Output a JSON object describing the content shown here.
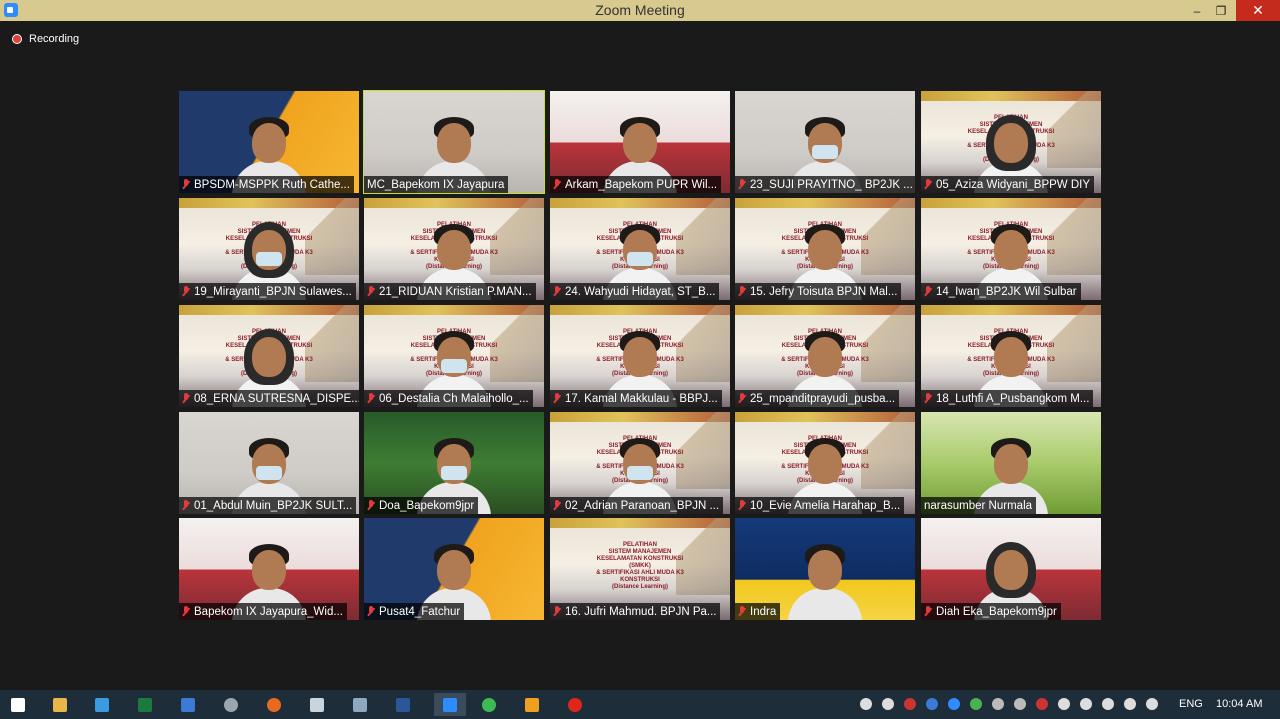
{
  "window": {
    "title": "Zoom Meeting",
    "minimize": "–",
    "maximize": "❐",
    "close": "✕"
  },
  "recording": {
    "label": "Recording"
  },
  "participants": [
    {
      "name": "BPSDM-MSPPK Ruth Cathe...",
      "bg": "orange",
      "person": "woman",
      "muted": true,
      "active": false
    },
    {
      "name": "MC_Bapekom IX Jayapura",
      "bg": "room",
      "person": "man",
      "muted": false,
      "active": true
    },
    {
      "name": "Arkam_Bapekom PUPR Wil...",
      "bg": "red",
      "person": "man",
      "muted": true,
      "active": false
    },
    {
      "name": "23_SUJI PRAYITNO_ BP2JK ...",
      "bg": "room",
      "person": "man-mask",
      "muted": true,
      "active": false
    },
    {
      "name": "05_Aziza Widyani_BPPW DIY",
      "bg": "slide",
      "person": "hijab",
      "muted": true,
      "active": false
    },
    {
      "name": "19_Mirayanti_BPJN Sulawes...",
      "bg": "slide",
      "person": "hijab-mask",
      "muted": true,
      "active": false
    },
    {
      "name": "21_RIDUAN Kristian P.MAN...",
      "bg": "slide",
      "person": "man",
      "muted": true,
      "active": false
    },
    {
      "name": "24. Wahyudi Hidayat, ST_B...",
      "bg": "slide",
      "person": "man-mask",
      "muted": true,
      "active": false
    },
    {
      "name": "15. Jefry Toisuta BPJN Mal...",
      "bg": "slide",
      "person": "man",
      "muted": true,
      "active": false
    },
    {
      "name": "14_Iwan_BP2JK Wil Sulbar",
      "bg": "slide",
      "person": "man",
      "muted": true,
      "active": false
    },
    {
      "name": "08_ERNA SUTRESNA_DISPE...",
      "bg": "slide",
      "person": "hijab",
      "muted": true,
      "active": false
    },
    {
      "name": "06_Destalia Ch Malaihollo_...",
      "bg": "slide",
      "person": "woman-mask",
      "muted": true,
      "active": false
    },
    {
      "name": "17. Kamal Makkulau - BBPJ...",
      "bg": "slide",
      "person": "man",
      "muted": true,
      "active": false
    },
    {
      "name": "25_mpanditprayudi_pusba...",
      "bg": "slide",
      "person": "man",
      "muted": true,
      "active": false
    },
    {
      "name": "18_Luthfi A_Pusbangkom M...",
      "bg": "slide",
      "person": "man",
      "muted": true,
      "active": false
    },
    {
      "name": "01_Abdul Muin_BP2JK SULT...",
      "bg": "room",
      "person": "man-mask",
      "muted": true,
      "active": false
    },
    {
      "name": "Doa_Bapekom9jpr",
      "bg": "green",
      "person": "man-mask",
      "muted": true,
      "active": false
    },
    {
      "name": "02_Adrian Paranoan_BPJN ...",
      "bg": "slide",
      "person": "man-mask",
      "muted": true,
      "active": false
    },
    {
      "name": "10_Evie Amelia Harahap_B...",
      "bg": "slide",
      "person": "man",
      "muted": true,
      "active": false
    },
    {
      "name": "narasumber Nurmala",
      "bg": "grass",
      "person": "woman",
      "muted": false,
      "active": false
    },
    {
      "name": "Bapekom IX Jayapura_Wid...",
      "bg": "red",
      "person": "man",
      "muted": true,
      "active": false
    },
    {
      "name": "Pusat4_Fatchur",
      "bg": "orange",
      "person": "man",
      "muted": true,
      "active": false
    },
    {
      "name": "16. Jufri Mahmud. BPJN Pa...",
      "bg": "slide",
      "person": "none",
      "muted": true,
      "active": false
    },
    {
      "name": "Indra",
      "bg": "yellow",
      "person": "man",
      "muted": true,
      "active": false
    },
    {
      "name": "Diah Eka_Bapekom9jpr",
      "bg": "red",
      "person": "hijab",
      "muted": true,
      "active": false
    }
  ],
  "slide_caption": "PELATIHAN\nSISTEM MANAJEMEN KESELAMATAN KONSTRUKSI (SMKK)\n& SERTIFIKASI AHLI MUDA K3 KONSTRUKSI\n(Distance Learning)",
  "taskbar": {
    "apps": [
      "start",
      "explorer",
      "ie",
      "excel",
      "shield",
      "chrome-alt",
      "firefox",
      "notepad",
      "files",
      "word",
      "zoom",
      "chrome",
      "media",
      "opera"
    ],
    "active_app": "zoom",
    "language": "ENG",
    "time": "10:04 AM"
  },
  "colors": {
    "active_outline": "#c5e02a",
    "close_red": "#c42b1c",
    "titlebar": "#d8c98f"
  }
}
